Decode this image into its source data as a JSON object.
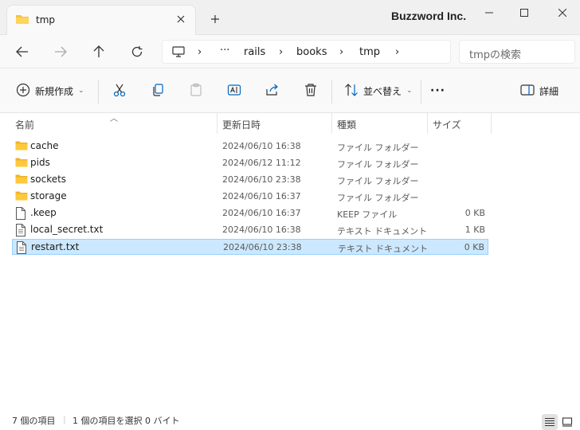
{
  "window": {
    "tab_title": "tmp",
    "watermark": "Buzzword Inc.",
    "colors": {
      "folder": "#f5c242",
      "selection": "#cce8ff",
      "accent": "#0067c0"
    }
  },
  "nav": {
    "breadcrumbs": [
      "rails",
      "books",
      "tmp"
    ],
    "overflow": "···",
    "search_placeholder": "tmpの検索"
  },
  "toolbar": {
    "new_label": "新規作成",
    "sort_label": "並べ替え",
    "more_label": "···",
    "details_label": "詳細"
  },
  "columns": {
    "name": "名前",
    "date": "更新日時",
    "type": "種類",
    "size": "サイズ"
  },
  "files": [
    {
      "name": "cache",
      "date": "2024/06/10 16:38",
      "type": "ファイル フォルダー",
      "size": "",
      "icon": "folder-icon"
    },
    {
      "name": "pids",
      "date": "2024/06/12 11:12",
      "type": "ファイル フォルダー",
      "size": "",
      "icon": "folder-icon"
    },
    {
      "name": "sockets",
      "date": "2024/06/10 23:38",
      "type": "ファイル フォルダー",
      "size": "",
      "icon": "folder-icon"
    },
    {
      "name": "storage",
      "date": "2024/06/10 16:37",
      "type": "ファイル フォルダー",
      "size": "",
      "icon": "folder-icon"
    },
    {
      "name": ".keep",
      "date": "2024/06/10 16:37",
      "type": "KEEP ファイル",
      "size": "0 KB",
      "icon": "file-icon"
    },
    {
      "name": "local_secret.txt",
      "date": "2024/06/10 16:38",
      "type": "テキスト ドキュメント",
      "size": "1 KB",
      "icon": "text-file-icon"
    },
    {
      "name": "restart.txt",
      "date": "2024/06/10 23:38",
      "type": "テキスト ドキュメント",
      "size": "0 KB",
      "icon": "text-file-icon",
      "selected": true
    }
  ],
  "status": {
    "count": "7 個の項目",
    "selection": "1 個の項目を選択 0 バイト"
  }
}
